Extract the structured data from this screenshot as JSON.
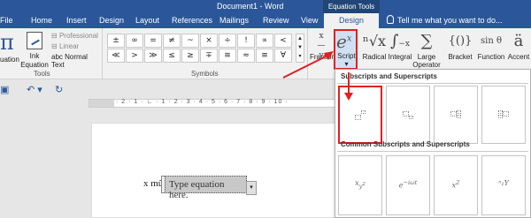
{
  "titlebar": {
    "document_title": "Document1 - Word",
    "context_group": "Equation Tools"
  },
  "tabs": [
    {
      "label": "File"
    },
    {
      "label": "Home"
    },
    {
      "label": "Insert"
    },
    {
      "label": "Design"
    },
    {
      "label": "Layout"
    },
    {
      "label": "References"
    },
    {
      "label": "Mailings"
    },
    {
      "label": "Review"
    },
    {
      "label": "View"
    }
  ],
  "active_tab": {
    "label": "Design"
  },
  "tell_me": {
    "placeholder": "Tell me what you want to do..."
  },
  "tools_group": {
    "equation_label": "Equation",
    "equation_partial": "uation",
    "ink_label": "Ink\nEquation",
    "ink_line1": "Ink",
    "ink_line2": "Equation",
    "formats": [
      {
        "label": "Professional",
        "active": false
      },
      {
        "label": "Linear",
        "active": false
      },
      {
        "label": "Normal Text",
        "active": true
      }
    ],
    "abc_prefix": "abc",
    "group_label": "Tools"
  },
  "symbols_group": {
    "group_label": "Symbols",
    "symbols": [
      "±",
      "∞",
      "=",
      "≠",
      "~",
      "×",
      "÷",
      "!",
      "∝",
      "<",
      "≪",
      ">",
      "≫",
      "≤",
      "≥",
      "∓",
      "≅",
      "≈",
      "≡",
      "∀",
      "∁",
      "∂"
    ]
  },
  "structures": [
    {
      "label": "Fraction",
      "glyph": "x/y"
    },
    {
      "label": "Script",
      "glyph": "eˣ"
    },
    {
      "label": "Radical",
      "glyph": "ⁿ√x"
    },
    {
      "label": "Integral",
      "glyph": "∫"
    },
    {
      "label": "Large\nOperator",
      "line1": "Large",
      "line2": "Operator",
      "glyph": "∑"
    },
    {
      "label": "Bracket",
      "glyph": "{()}"
    },
    {
      "label": "Function",
      "glyph": "sin θ"
    },
    {
      "label": "Accent",
      "glyph": "ä"
    }
  ],
  "gallery": {
    "section1": "Subscripts and Superscripts",
    "section2": "Common Subscripts and Superscripts",
    "tiles_row1": [
      "superscript",
      "subscript",
      "subscript-superscript",
      "left-subscript-superscript"
    ],
    "tiles_row2": [
      "x_{y^2}",
      "e^{-iωt}",
      "x^2",
      "ⁿ₁Y"
    ]
  },
  "document": {
    "pretext": "x mũ",
    "equation_placeholder": "Type equation here."
  },
  "ruler": {
    "marks": "· 2 · 1 · ∟ · 1 · 2 · 3 · 4 · 5 · 6 · 7 · 8 · 9 · 10 ·"
  },
  "accent_color": "#2b579a",
  "annotation_color": "#e02020"
}
